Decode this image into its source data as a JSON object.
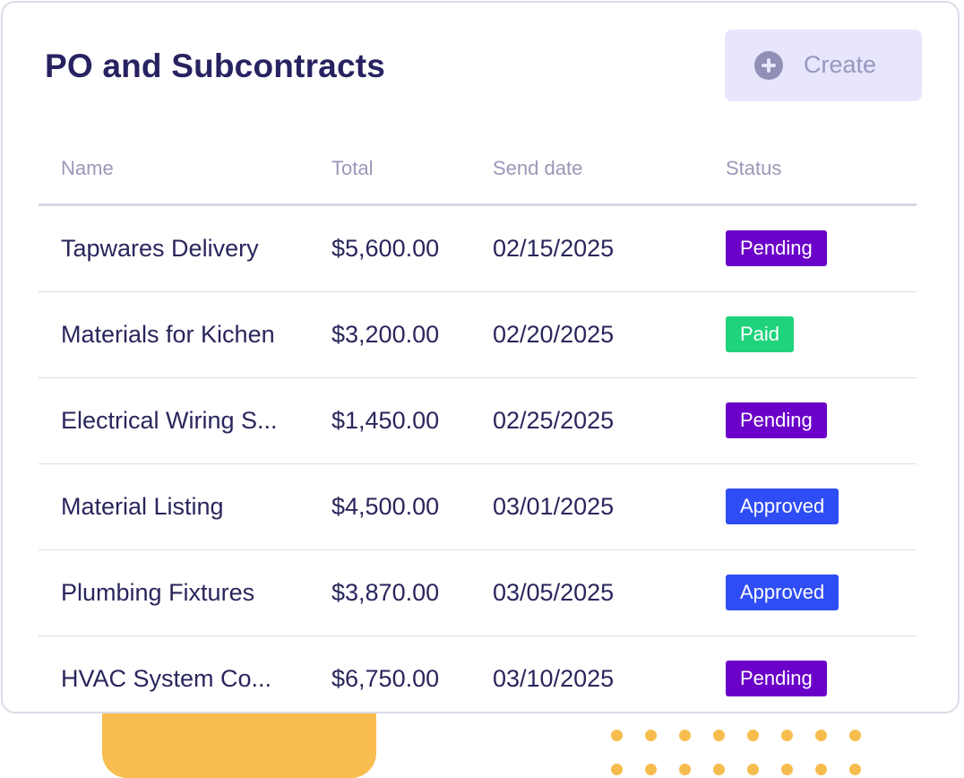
{
  "header": {
    "title": "PO and Subcontracts",
    "create_label": "Create",
    "create_icon": "plus-circle-icon"
  },
  "table": {
    "columns": [
      "Name",
      "Total",
      "Send date",
      "Status"
    ],
    "rows": [
      {
        "name": "Tapwares Delivery",
        "total": "$5,600.00",
        "send_date": "02/15/2025",
        "status": "Pending"
      },
      {
        "name": "Materials for Kichen",
        "total": "$3,200.00",
        "send_date": "02/20/2025",
        "status": "Paid"
      },
      {
        "name": "Electrical Wiring S...",
        "total": "$1,450.00",
        "send_date": "02/25/2025",
        "status": "Pending"
      },
      {
        "name": "Material Listing",
        "total": "$4,500.00",
        "send_date": "03/01/2025",
        "status": "Approved"
      },
      {
        "name": "Plumbing Fixtures",
        "total": "$3,870.00",
        "send_date": "03/05/2025",
        "status": "Approved"
      },
      {
        "name": "HVAC System Co...",
        "total": "$6,750.00",
        "send_date": "03/10/2025",
        "status": "Pending"
      }
    ]
  },
  "colors": {
    "Pending": "#6b00c9",
    "Paid": "#1fd37c",
    "Approved": "#2f4df5",
    "title": "#272361",
    "accent_yellow": "#f9bc4e"
  }
}
